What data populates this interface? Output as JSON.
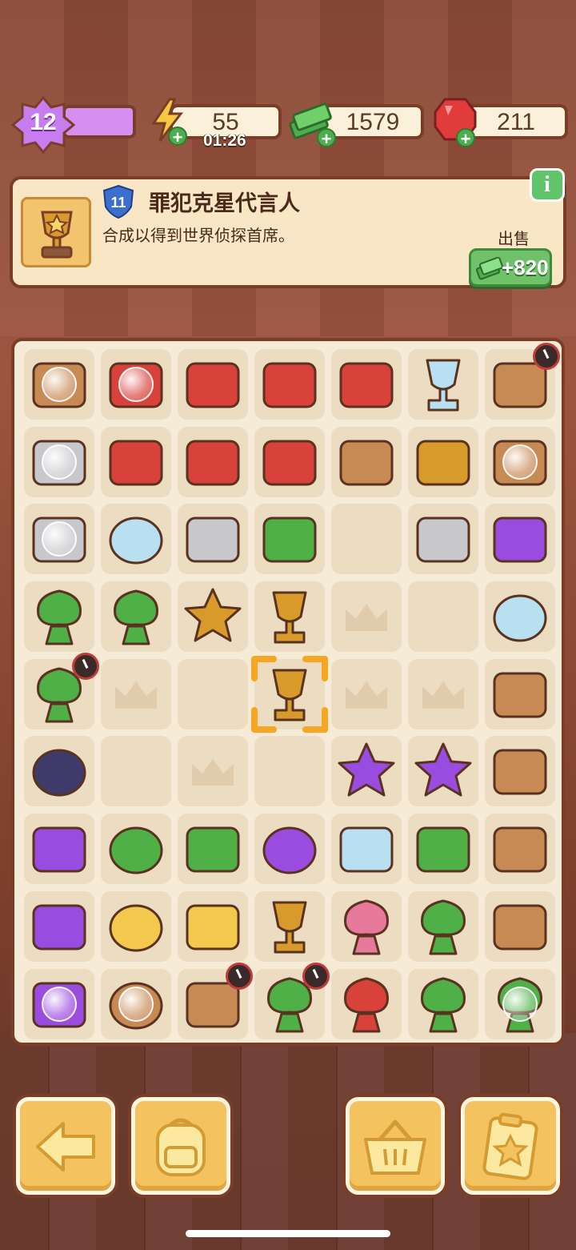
{
  "top_bar": {
    "level": "12",
    "energy": {
      "value": "55",
      "timer": "01:26",
      "icon": "lightning-icon"
    },
    "cash": {
      "value": "1579",
      "icon": "cash-stack-icon"
    },
    "gems": {
      "value": "211",
      "icon": "red-gem-icon"
    }
  },
  "info_panel": {
    "level_badge": "11",
    "title": "罪犯克星代言人",
    "description": "合成以得到世界侦探首席。",
    "sell_label": "出售",
    "sell_price": "+820",
    "item_icon": "gold-trophy-icon"
  },
  "board": {
    "rows": 9,
    "cols": 7,
    "cells": [
      [
        "crime-scene-tape-box",
        "red-tool-kit-open",
        "red-toolbox-large",
        "red-toolbox-open",
        "red-tray-box",
        "porcelain-vase",
        "cardboard-box-open"
      ],
      [
        "evidence-fence",
        "red-pliers",
        "red-axe",
        "trowel",
        "garden-fork",
        "yellow-barrier",
        "wooden-crate-open"
      ],
      [
        "evidence-case",
        "yellow-glasses",
        "footprint-photo",
        "cash-pile",
        "empty",
        "shoeprint-photo",
        "dark-ink-drop"
      ],
      [
        "green-sprout",
        "green-bush",
        "crystal-star-trophy",
        "crystal-round-trophy",
        "ghost",
        "empty",
        "magnifier"
      ],
      [
        "potted-plant",
        "ghost",
        "empty",
        "gold-trophy",
        "ghost",
        "ghost",
        "stacked-boxes"
      ],
      [
        "bike-wheels",
        "empty",
        "ghost",
        "empty",
        "purple-star",
        "purple-star-smile",
        "flat-box-stack"
      ],
      [
        "purple-bicycle",
        "green-sponge",
        "green-brush",
        "purple-blob",
        "crystal-shield",
        "cash-bundle",
        "flat-box"
      ],
      [
        "purple-scooter",
        "yellow-frisbee",
        "yellow-bucket",
        "gold-figure",
        "flower-bouquet-blue",
        "bonsai-small",
        "clay-pot"
      ],
      [
        "purple-car",
        "yellow-pumpkin-pot",
        "family-portrait",
        "bonsai-medium",
        "flower-bouquet-red",
        "bonsai-tall",
        "potted-herb"
      ]
    ]
  },
  "bottom_buttons": [
    {
      "name": "back-button",
      "icon": "arrow-left-icon"
    },
    {
      "name": "backpack-button",
      "icon": "backpack-icon"
    },
    {
      "name": "shop-basket-button",
      "icon": "basket-icon"
    },
    {
      "name": "tasks-clipboard-button",
      "icon": "clipboard-star-icon"
    }
  ],
  "colors": {
    "accent_purple": "#c77cf0",
    "panel_bg": "#f8e6c4",
    "border_brown": "#7a3e28",
    "button_yellow": "#f4c360",
    "sell_green": "#6fc26a"
  }
}
